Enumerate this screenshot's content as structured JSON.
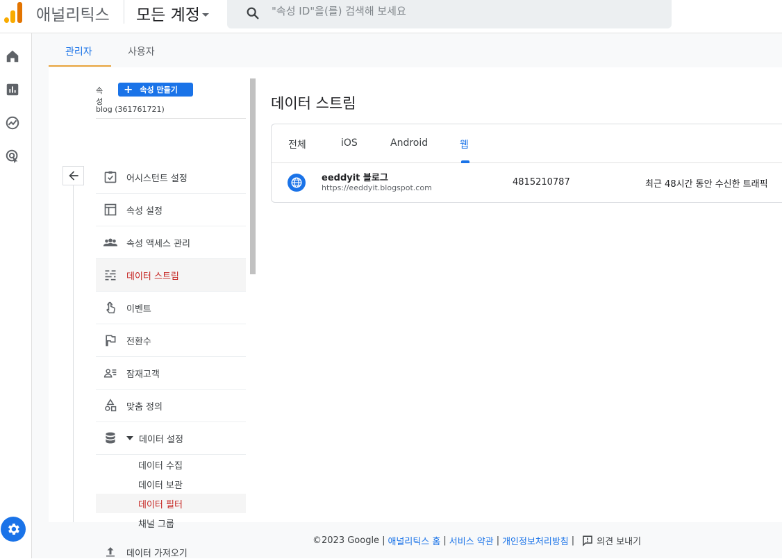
{
  "header": {
    "app_name": "애널리틱스",
    "account": "모든 계정",
    "search_placeholder": "\"속성 ID\"을(를) 검색해 보세요"
  },
  "rail": {
    "items": [
      "home-icon",
      "reports-icon",
      "explore-icon",
      "advertising-icon"
    ],
    "settings_icon": "gear-icon"
  },
  "admin_tabs": [
    {
      "label": "관리자",
      "active": true
    },
    {
      "label": "사용자",
      "active": false
    }
  ],
  "property": {
    "label": "속성",
    "create_button": "속성 만들기",
    "selected": "blog (361761721)"
  },
  "menu": [
    {
      "label": "어시스턴트 설정",
      "icon": "checklist-icon"
    },
    {
      "label": "속성 설정",
      "icon": "layout-icon"
    },
    {
      "label": "속성 액세스 관리",
      "icon": "people-icon"
    },
    {
      "label": "데이터 스트림",
      "icon": "streams-icon",
      "active": true
    },
    {
      "label": "이벤트",
      "icon": "touch-icon"
    },
    {
      "label": "전환수",
      "icon": "flag-icon"
    },
    {
      "label": "잠재고객",
      "icon": "audience-icon"
    },
    {
      "label": "맞춤 정의",
      "icon": "shapes-icon"
    },
    {
      "label": "데이터 설정",
      "icon": "database-icon",
      "expanded": true
    }
  ],
  "submenu": [
    {
      "label": "데이터 수집"
    },
    {
      "label": "데이터 보관"
    },
    {
      "label": "데이터 필터",
      "active": true
    },
    {
      "label": "채널 그룹"
    }
  ],
  "menu_last": {
    "label": "데이터 가져오기",
    "icon": "upload-icon"
  },
  "streams": {
    "title": "데이터 스트림",
    "tabs": [
      {
        "label": "전체"
      },
      {
        "label": "iOS"
      },
      {
        "label": "Android"
      },
      {
        "label": "웹",
        "active": true
      }
    ],
    "rows": [
      {
        "name": "eeddyit 블로그",
        "url": "https://eeddyit.blogspot.com",
        "id": "4815210787",
        "status": "최근 48시간 동안 수신한 트래픽"
      }
    ]
  },
  "footer": {
    "copyright": "©2023 Google",
    "links": [
      "애널리틱스 홈",
      "서비스 약관",
      "개인정보처리방침"
    ],
    "feedback": "의견 보내기"
  },
  "colors": {
    "accent": "#1a73e8",
    "active_menu": "#c5221f",
    "logo": "#f9ab00",
    "tab_underline": "#e8a33a"
  }
}
